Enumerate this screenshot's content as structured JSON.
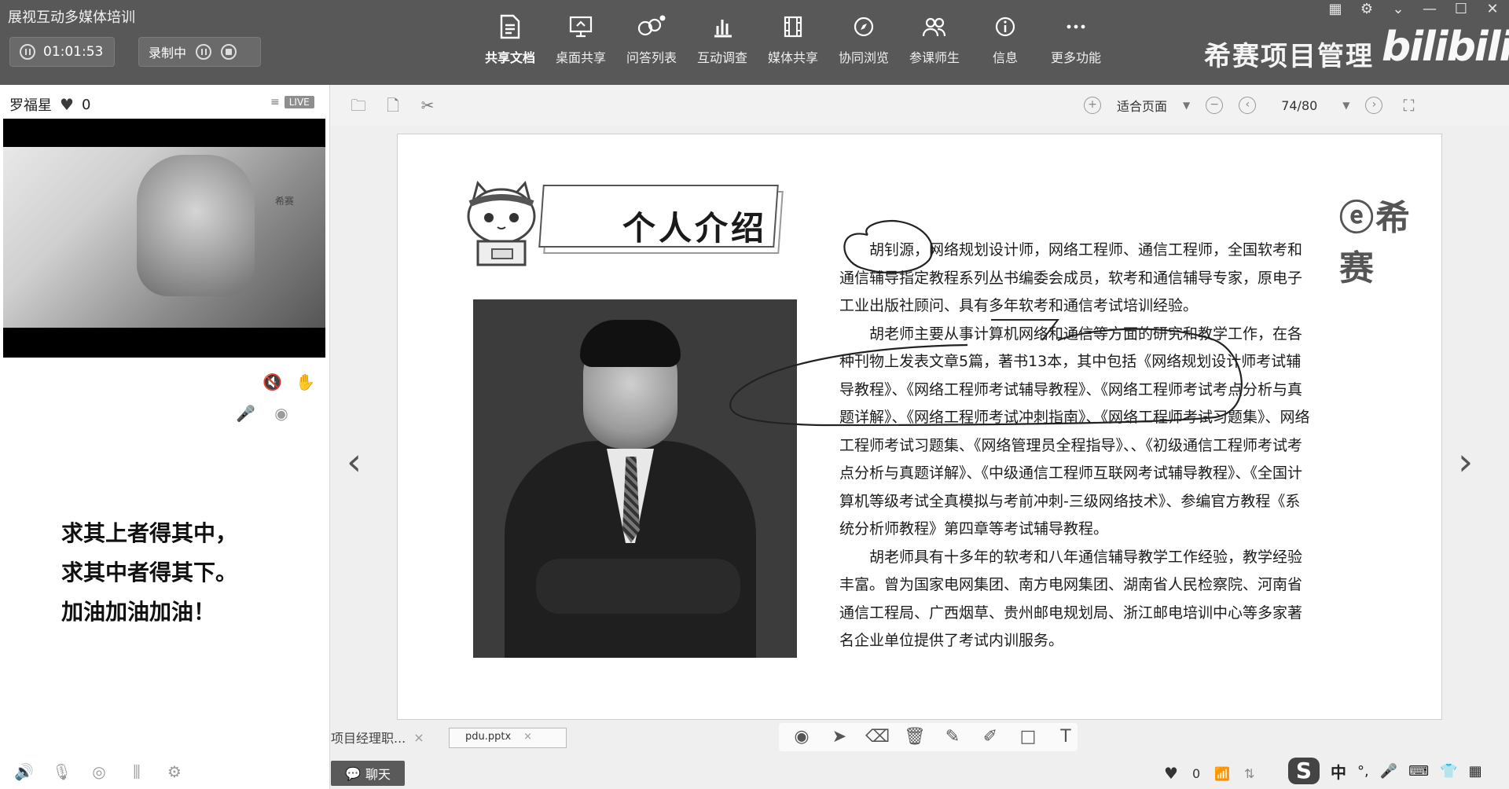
{
  "app": {
    "title": "展视互动多媒体培训"
  },
  "session": {
    "timer": "01:01:53",
    "recording_label": "录制中"
  },
  "toolbar": {
    "items": [
      {
        "label": "共享文档",
        "icon": "document-share-icon",
        "active": true
      },
      {
        "label": "桌面共享",
        "icon": "desktop-share-icon",
        "active": false
      },
      {
        "label": "问答列表",
        "icon": "qa-list-icon",
        "active": false
      },
      {
        "label": "互动调查",
        "icon": "survey-chart-icon",
        "active": false
      },
      {
        "label": "媒体共享",
        "icon": "media-share-icon",
        "active": false
      },
      {
        "label": "协同浏览",
        "icon": "compass-icon",
        "active": false
      },
      {
        "label": "参课师生",
        "icon": "participants-icon",
        "active": false
      },
      {
        "label": "信息",
        "icon": "info-icon",
        "active": false
      },
      {
        "label": "更多功能",
        "icon": "more-dots-icon",
        "active": false
      }
    ]
  },
  "brand": {
    "name": "希赛项目管理",
    "site_logo": "bilibili"
  },
  "presenter": {
    "name": "罗福星",
    "likes": "0",
    "live_label": "LIVE",
    "video_watermark": "希赛"
  },
  "motto": {
    "lines": [
      "求其上者得其中，",
      "求其中者得其下。",
      "加油加油加油！"
    ]
  },
  "viewer": {
    "zoom_mode": "适合页面",
    "page_indicator": "74/80"
  },
  "slide": {
    "title": "个人介绍",
    "logo_text": "希赛",
    "bio_paragraphs": [
      "胡钊源，网络规划设计师，网络工程师、通信工程师，全国软考和通信辅导指定教程系列丛书编委会成员，软考和通信辅导专家，原电子工业出版社顾问、具有多年软考和通信考试培训经验。",
      "胡老师主要从事计算机网络和通信等方面的研究和教学工作，在各种刊物上发表文章5篇，著书13本，其中包括《网络规划设计师考试辅导教程》、《网络工程师考试辅导教程》、《网络工程师考试考点分析与真题详解》、《网络工程师考试冲刺指南》、《网络工程师考试习题集》、网络工程师考试习题集、《网络管理员全程指导》、、《初级通信工程师考试考点分析与真题详解》、《中级通信工程师互联网考试辅导教程》、《全国计算机等级考试全真模拟与考前冲刺-三级网络技术》、参编官方教程《系统分析师教程》第四章等考试辅导教程。",
      "胡老师具有十多年的软考和八年通信辅导教学工作经验，教学经验丰富。曾为国家电网集团、南方电网集团、湖南省人民检察院、河南省通信工程局、广西烟草、贵州邮电规划局、浙江邮电培训中心等多家著名企业单位提供了考试内训服务。"
    ]
  },
  "docs": {
    "tab1": "项目经理职...",
    "tab2": "pdu.pptx",
    "close": "×"
  },
  "status": {
    "chat_label": "聊天",
    "likes": "0",
    "ime_logo": "S",
    "ime_lang": "中"
  }
}
